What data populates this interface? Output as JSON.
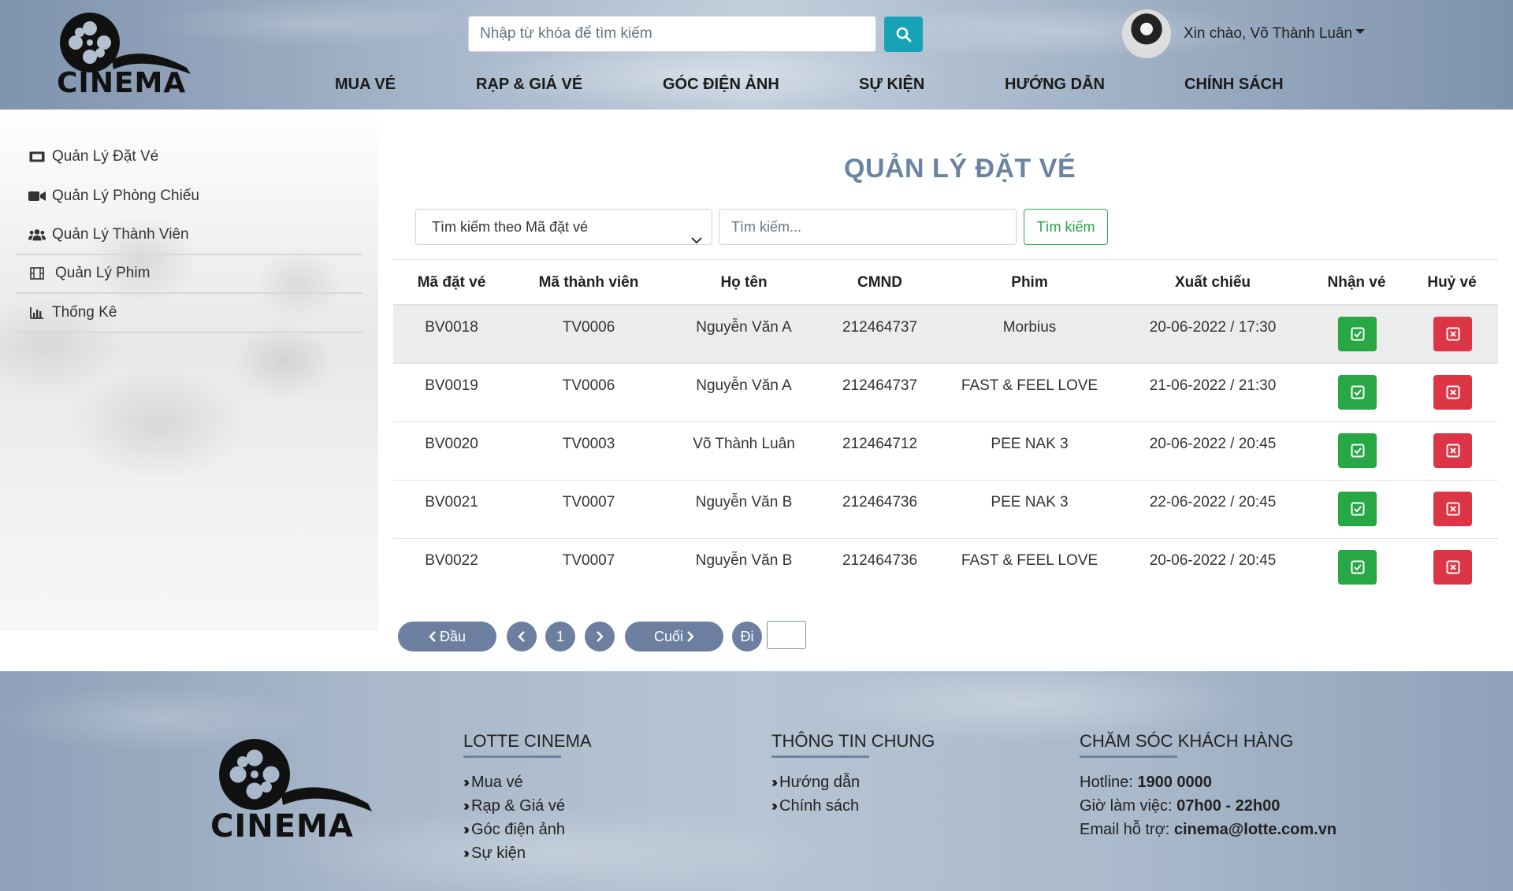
{
  "header": {
    "logo_text": "CINEMA",
    "search_placeholder": "Nhập từ khóa để tìm kiếm",
    "greeting": "Xin chào, Võ Thành Luân",
    "nav": [
      "MUA VÉ",
      "RẠP & GIÁ VÉ",
      "GÓC ĐIỆN ẢNH",
      "SỰ KIỆN",
      "HƯỚNG DẪN",
      "CHÍNH SÁCH"
    ]
  },
  "sidebar": {
    "items": [
      {
        "label": "Quản Lý Đặt Vé",
        "icon": "ticket-icon"
      },
      {
        "label": "Quản Lý Phòng Chiếu",
        "icon": "video-camera-icon"
      },
      {
        "label": "Quản Lý Thành Viên",
        "icon": "users-icon"
      },
      {
        "label": "Quản Lý Phim",
        "icon": "film-icon"
      },
      {
        "label": "Thống Kê",
        "icon": "bar-chart-icon"
      }
    ]
  },
  "main": {
    "title": "QUẢN LÝ ĐẶT VÉ",
    "filter": {
      "selected": "Tìm kiếm theo Mã đặt vé",
      "input_placeholder": "Tìm kiếm...",
      "button": "Tìm kiếm"
    },
    "table": {
      "headers": [
        "Mã đặt vé",
        "Mã thành viên",
        "Họ tên",
        "CMND",
        "Phim",
        "Xuất chiếu",
        "Nhận vé",
        "Huỷ vé"
      ],
      "rows": [
        [
          "BV0018",
          "TV0006",
          "Nguyễn Văn A",
          "212464737",
          "Morbius",
          "20-06-2022 / 17:30"
        ],
        [
          "BV0019",
          "TV0006",
          "Nguyễn Văn A",
          "212464737",
          "FAST & FEEL LOVE",
          "21-06-2022 / 21:30"
        ],
        [
          "BV0020",
          "TV0003",
          "Võ Thành Luân",
          "212464712",
          "PEE NAK 3",
          "20-06-2022 / 20:45"
        ],
        [
          "BV0021",
          "TV0007",
          "Nguyễn Văn B",
          "212464736",
          "PEE NAK 3",
          "22-06-2022 / 20:45"
        ],
        [
          "BV0022",
          "TV0007",
          "Nguyễn Văn B",
          "212464736",
          "FAST & FEEL LOVE",
          "20-06-2022 / 20:45"
        ]
      ]
    },
    "pagination": {
      "first": "Đầu",
      "page": "1",
      "last": "Cuối",
      "go": "Đi"
    }
  },
  "footer": {
    "logo_text": "CINEMA",
    "col1": {
      "title": "LOTTE CINEMA",
      "links": [
        "Mua vé",
        "Rạp & Giá vé",
        "Góc điện ảnh",
        "Sự kiện"
      ]
    },
    "col2": {
      "title": "THÔNG TIN CHUNG",
      "links": [
        "Hướng dẫn",
        "Chính sách"
      ]
    },
    "col3": {
      "title": "CHĂM SÓC KHÁCH HÀNG",
      "hotline_label": "Hotline: ",
      "hotline": "1900 0000",
      "hours_label": "Giờ làm việc: ",
      "hours": "07h00 - 22h00",
      "email_label": "Email hỗ trợ: ",
      "email": "cinema@lotte.com.vn"
    }
  },
  "colors": {
    "accent": "#6b84a0",
    "success": "#28a745",
    "danger": "#dc3545",
    "info": "#17a2b8"
  }
}
